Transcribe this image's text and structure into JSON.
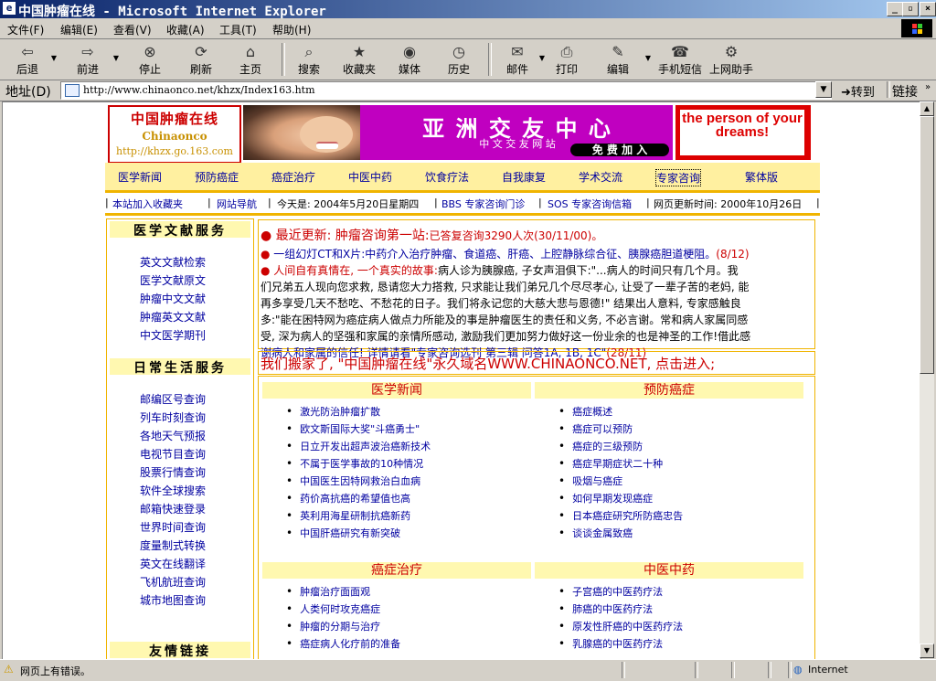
{
  "window": {
    "title": "中国肿瘤在线 - Microsoft Internet Explorer",
    "minimize": "_",
    "maximize": "▫",
    "close": "×"
  },
  "menu": [
    "文件(F)",
    "编辑(E)",
    "查看(V)",
    "收藏(A)",
    "工具(T)",
    "帮助(H)"
  ],
  "toolbar": {
    "back": "后退",
    "forward": "前进",
    "stop": "停止",
    "refresh": "刷新",
    "home": "主页",
    "search": "搜索",
    "favorites": "收藏夹",
    "media": "媒体",
    "history": "历史",
    "mail": "邮件",
    "print": "打印",
    "edit": "编辑",
    "sms": "手机短信",
    "helper": "上网助手"
  },
  "address": {
    "label": "地址(D)",
    "url": "http://www.chinaonco.net/khzx/Index163.htm",
    "go": "转到",
    "links": "链接"
  },
  "logo": {
    "title": "中国肿瘤在线",
    "sub": "Chinaonco",
    "url": "http://khzx.go.163.com"
  },
  "banner": {
    "title": "亚 洲 交 友 中 心",
    "sub": "中 文 交 友 网 站",
    "join": "免 费 加 入"
  },
  "ad": {
    "text": "the person of your dreams!"
  },
  "nav": [
    "医学新闻",
    "预防癌症",
    "癌症治疗",
    "中医中药",
    "饮食疗法",
    "自我康复",
    "学术交流",
    "专家咨询",
    "繁体版"
  ],
  "infobar": [
    "本站加入收藏夹",
    "网站导航",
    "今天是: 2004年5月20日星期四",
    "BBS 专家咨询门诊",
    "SOS 专家咨询信箱",
    "网页更新时间: 2000年10月26日"
  ],
  "sidebar": {
    "medical_head": "医学文献服务",
    "medical_links": [
      "英文文献检索",
      "医学文献原文",
      "肿瘤中文文献",
      "肿瘤英文文献",
      "中文医学期刊"
    ],
    "life_head": "日常生活服务",
    "life_links": [
      "邮编区号查询",
      "列车时刻查询",
      "各地天气预报",
      "电视节目查询",
      "股票行情查询",
      "软件全球搜索",
      "邮箱快速登录",
      "世界时间查询",
      "度量制式转换",
      "英文在线翻译",
      "飞机航班查询",
      "城市地图查询"
    ],
    "friends_head": "友情链接"
  },
  "news": {
    "line1_a": "最近更新: 肿瘤咨询第一站:",
    "line1_b": "已答复咨询3290人次(30/11/00)。",
    "line2": "一组幻灯CT和X片:中药介入治疗肿瘤、食道癌、肝癌、上腔静脉综合征、胰腺癌胆道梗阻。",
    "line2_date": "(8/12)",
    "line3_a": "人间自有真情在, 一个真实的故事:",
    "line3_b": "病人诊为胰腺癌, 子女声泪俱下:\"...病人的时间只有几个月。我",
    "line4": "们兄弟五人现向您求救, 恳请您大力搭救, 只求能让我们弟兄几个尽尽孝心, 让受了一辈子苦的老妈, 能",
    "line5": "再多享受几天不愁吃、不愁花的日子。我们将永记您的大慈大悲与恩德!\" 结果出人意料, 专家感触良",
    "line6": "多:\"能在困特网为癌症病人做点力所能及的事是肿瘤医生的责任和义务, 不必言谢。常和病人家属同感",
    "line7": "受, 深为病人的坚强和家属的亲情所感动, 激励我们更加努力做好这一份业余的也是神圣的工作!借此感",
    "line8_a": "谢病人和家属的信任! 详情请看\"专家咨询选刊 第三辑 问答1A, 1B, 1C\"",
    "line8_b": "(28/11)"
  },
  "moving": "我们搬家了, \"中国肿瘤在线\"永久域名WWW.CHINAONCO.NET, 点击进入;",
  "sections": {
    "s1_head": "医学新闻",
    "s1": [
      "激光防治肿瘤扩散",
      "欧文斯国际大奖\"斗癌勇士\"",
      "日立开发出超声波治癌新技术",
      "不属于医学事故的10种情况",
      "中国医生因特网救治白血病",
      "药价高抗癌的希望值也高",
      "英利用海星研制抗癌新药",
      "中国肝癌研究有新突破"
    ],
    "s2_head": "预防癌症",
    "s2": [
      "癌症概述",
      "癌症可以预防",
      "癌症的三级预防",
      "癌症早期症状二十种",
      "吸烟与癌症",
      "如何早期发现癌症",
      "日本癌症研究所防癌忠告",
      "谈谈金属致癌"
    ],
    "s3_head": "癌症治疗",
    "s3": [
      "肿瘤治疗面面观",
      "人类何时攻克癌症",
      "肿瘤的分期与治疗",
      "癌症病人化疗前的准备"
    ],
    "s4_head": "中医中药",
    "s4": [
      "子宫癌的中医药疗法",
      "肺癌的中医药疗法",
      "原发性肝癌的中医药疗法",
      "乳腺癌的中医药疗法"
    ]
  },
  "status": {
    "text": "网页上有错误。",
    "zone": "Internet"
  }
}
